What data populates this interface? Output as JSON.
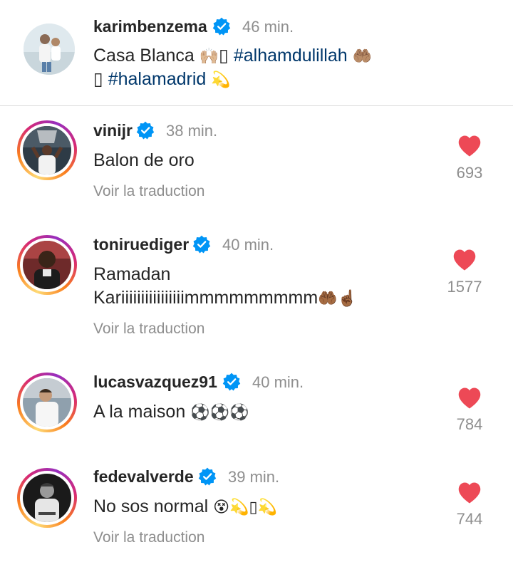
{
  "post": {
    "username": "karimbenzema",
    "time": "46 min.",
    "caption_text": "Casa Blanca ",
    "caption_emoji_1": "🙌🏼",
    "caption_box_1": "▯",
    "caption_hashtag_1": "#alhamdulillah",
    "caption_emoji_2": "🤲🏽",
    "caption_box_2": "▯",
    "caption_hashtag_2": "#halamadrid",
    "caption_emoji_3": "💫"
  },
  "comments": [
    {
      "username": "vinijr",
      "time": "38 min.",
      "text": "Balon de oro",
      "translate": "Voir la traduction",
      "likes": "693"
    },
    {
      "username": "toniruediger",
      "time": "40 min.",
      "text_line1": "Ramadan",
      "text_line2": "Kariiiiiiiiiiiiiiiimmmmmmmmm",
      "emoji": "🤲🏾☝🏾",
      "translate": "Voir la traduction",
      "likes": "1577"
    },
    {
      "username": "lucasvazquez91",
      "time": "40 min.",
      "text": "A la maison ",
      "emoji": "⚽⚽⚽",
      "likes": "784"
    },
    {
      "username": "fedevalverde",
      "time": "39 min.",
      "text": "No sos normal ",
      "emoji": "😵💫▯💫",
      "translate": "Voir la traduction",
      "likes": "744"
    }
  ],
  "colors": {
    "accent_like": "#ed4956",
    "verified": "#0095f6",
    "hashtag": "#00376b",
    "muted": "#8e8e8e"
  },
  "icons": {
    "verified": "verified-badge-icon",
    "like": "heart-icon"
  }
}
